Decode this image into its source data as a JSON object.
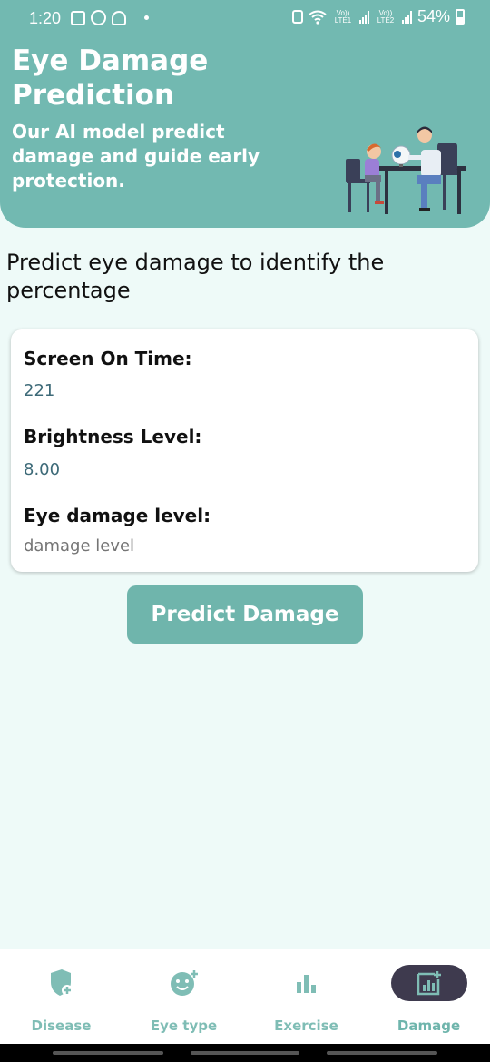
{
  "status": {
    "time": "1:20",
    "battery": "54%",
    "sim1": "Vo)) LTE1",
    "sim2": "Vo)) LTE2"
  },
  "header": {
    "title": "Eye Damage Prediction",
    "subtitle": "Our AI model predict damage and guide early protection."
  },
  "intro_text": "Predict eye damage to identify the percentage",
  "form": {
    "screen_time_label": "Screen On Time:",
    "screen_time_value": "221",
    "brightness_label": "Brightness Level:",
    "brightness_value": "8.00",
    "damage_label": "Eye damage level:",
    "damage_placeholder": "damage level"
  },
  "predict_button": "Predict Damage",
  "nav": {
    "items": [
      {
        "label": "Disease",
        "icon": "shield-plus-icon"
      },
      {
        "label": "Eye type",
        "icon": "smiley-plus-icon"
      },
      {
        "label": "Exercise",
        "icon": "bar-chart-icon"
      },
      {
        "label": "Damage",
        "icon": "chart-plus-icon"
      }
    ],
    "active_index": 3
  },
  "colors": {
    "primary": "#72b9b1",
    "background": "#eefaf8",
    "value_text": "#3d6a78",
    "nav_active_bg": "#3e3a4e"
  }
}
